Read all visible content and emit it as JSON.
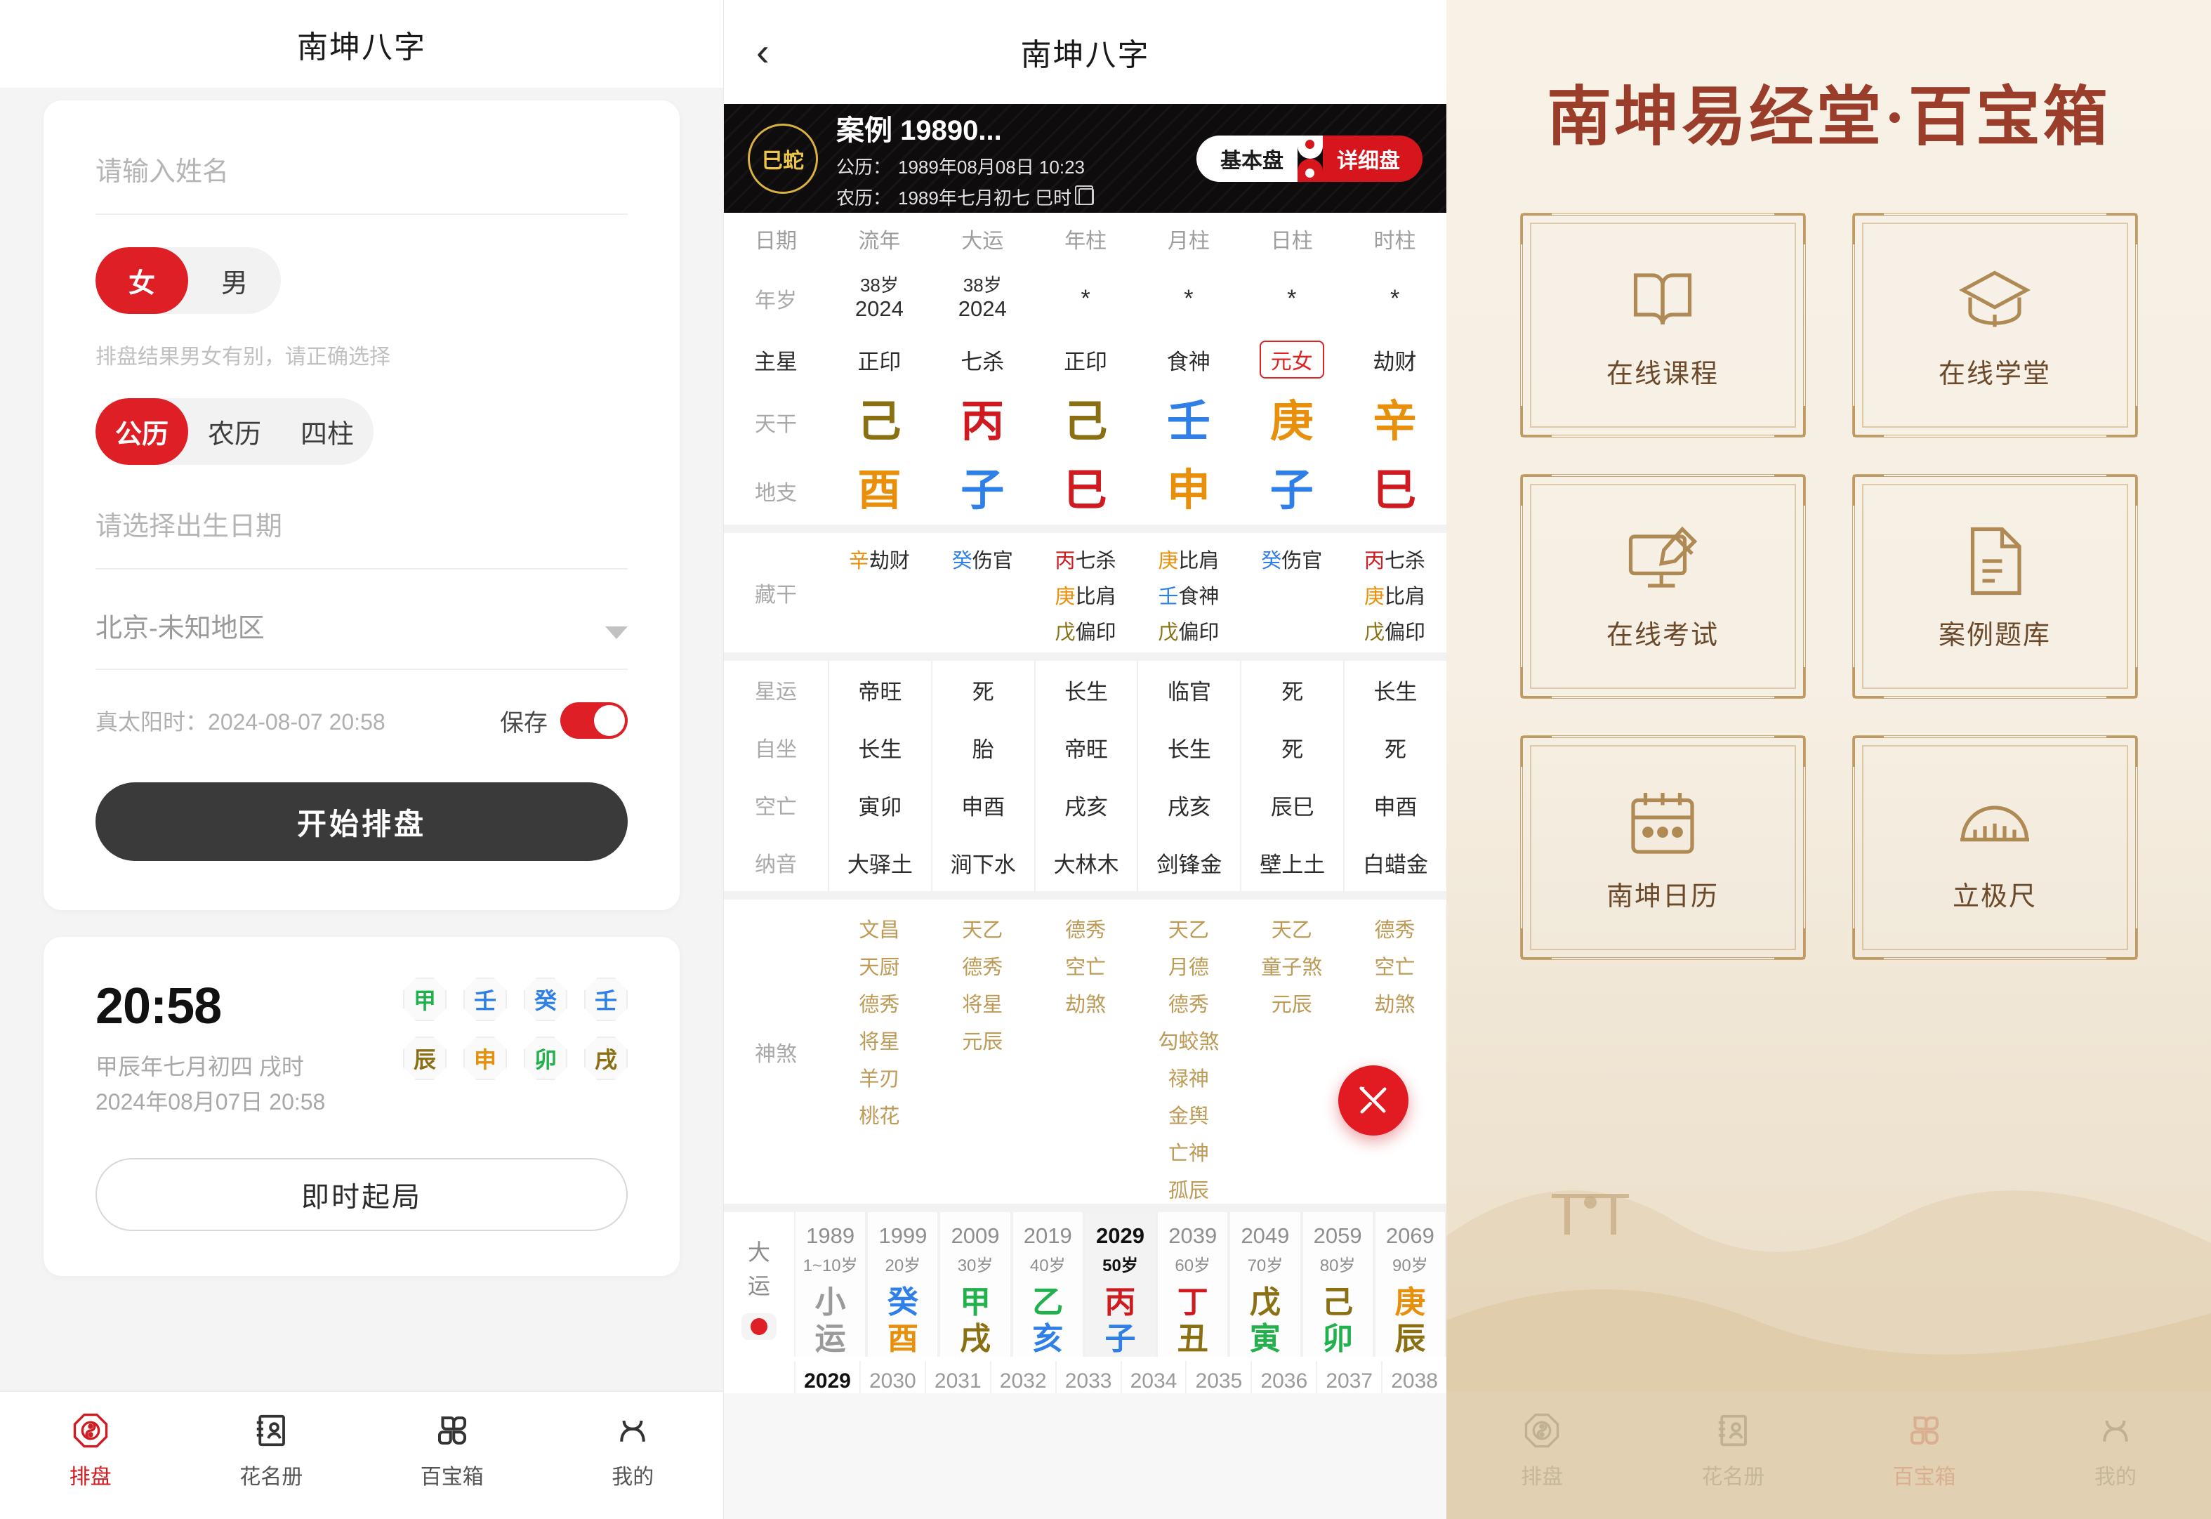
{
  "panel_form": {
    "title": "南坤八字",
    "name_placeholder": "请输入姓名",
    "gender": {
      "options": [
        "女",
        "男"
      ],
      "selected": "女"
    },
    "gender_hint": "排盘结果男女有别，请正确选择",
    "calendar": {
      "options": [
        "公历",
        "农历",
        "四柱"
      ],
      "selected": "公历"
    },
    "birthdate_placeholder": "请选择出生日期",
    "region_value": "北京-未知地区",
    "true_solar_label": "真太阳时：",
    "true_solar_value": "2024-08-07 20:58",
    "save_label": "保存",
    "save_on": true,
    "start_button": "开始排盘",
    "clock": {
      "time": "20:58",
      "lunar": "甲辰年七月初四 戌时",
      "solar": "2024年08月07日 20:58",
      "stems": [
        {
          "char": "甲",
          "color": "#22b14c"
        },
        {
          "char": "壬",
          "color": "#2e7fe8"
        },
        {
          "char": "癸",
          "color": "#2e7fe8"
        },
        {
          "char": "壬",
          "color": "#2e7fe8"
        }
      ],
      "branches": [
        {
          "char": "辰",
          "color": "#8a7012"
        },
        {
          "char": "申",
          "color": "#e8900c"
        },
        {
          "char": "卯",
          "color": "#22b14c"
        },
        {
          "char": "戌",
          "color": "#8a7012"
        }
      ]
    },
    "instant_button": "即时起局",
    "tabs": [
      {
        "label": "排盘",
        "icon": "bagua-icon",
        "active": true
      },
      {
        "label": "花名册",
        "icon": "roster-icon",
        "active": false
      },
      {
        "label": "百宝箱",
        "icon": "toolbox-icon",
        "active": false
      },
      {
        "label": "我的",
        "icon": "profile-icon",
        "active": false
      }
    ]
  },
  "panel_chart": {
    "title": "南坤八字",
    "back_icon": "chevron-left-icon",
    "banner": {
      "zodiac": "巳蛇",
      "case_name": "案例 19890...",
      "solar_label": "公历：",
      "solar_value": "1989年08月08日 10:23",
      "lunar_label": "农历：",
      "lunar_value": "1989年七月初七 巳时",
      "copy_icon": "copy-icon",
      "toggle": {
        "left": "基本盘",
        "right": "详细盘",
        "selected": "详细盘"
      }
    },
    "columns": [
      "日期",
      "流年",
      "大运",
      "年柱",
      "月柱",
      "日柱",
      "时柱"
    ],
    "rows": {
      "age_label": "年岁",
      "age": [
        {
          "top": "38岁",
          "bottom": "2024"
        },
        {
          "top": "38岁",
          "bottom": "2024"
        },
        {
          "top": "*",
          "bottom": ""
        },
        {
          "top": "*",
          "bottom": ""
        },
        {
          "top": "*",
          "bottom": ""
        },
        {
          "top": "*",
          "bottom": ""
        }
      ],
      "main_star_label": "主星",
      "main_star": [
        {
          "text": "正印",
          "badge": false
        },
        {
          "text": "七杀",
          "badge": false
        },
        {
          "text": "正印",
          "badge": false
        },
        {
          "text": "食神",
          "badge": false
        },
        {
          "text": "元女",
          "badge": true
        },
        {
          "text": "劫财",
          "badge": false
        }
      ],
      "stem_label": "天干",
      "stems": [
        {
          "char": "己",
          "color": "#8a7012"
        },
        {
          "char": "丙",
          "color": "#cf1a20"
        },
        {
          "char": "己",
          "color": "#8a7012"
        },
        {
          "char": "壬",
          "color": "#2e7fe8"
        },
        {
          "char": "庚",
          "color": "#e8900c"
        },
        {
          "char": "辛",
          "color": "#e8900c"
        }
      ],
      "branch_label": "地支",
      "branches": [
        {
          "char": "酉",
          "color": "#e8900c"
        },
        {
          "char": "子",
          "color": "#2e7fe8"
        },
        {
          "char": "巳",
          "color": "#cf1a20"
        },
        {
          "char": "申",
          "color": "#e8900c"
        },
        {
          "char": "子",
          "color": "#2e7fe8"
        },
        {
          "char": "巳",
          "color": "#cf1a20"
        }
      ],
      "hidden_label": "藏干",
      "hidden": [
        [
          {
            "g": "辛",
            "c": "#e8900c",
            "t": "劫财"
          }
        ],
        [
          {
            "g": "癸",
            "c": "#2e7fe8",
            "t": "伤官"
          }
        ],
        [
          {
            "g": "丙",
            "c": "#cf1a20",
            "t": "七杀"
          },
          {
            "g": "庚",
            "c": "#e8900c",
            "t": "比肩"
          },
          {
            "g": "戊",
            "c": "#8a7012",
            "t": "偏印"
          }
        ],
        [
          {
            "g": "庚",
            "c": "#e8900c",
            "t": "比肩"
          },
          {
            "g": "壬",
            "c": "#2e7fe8",
            "t": "食神"
          },
          {
            "g": "戊",
            "c": "#8a7012",
            "t": "偏印"
          }
        ],
        [
          {
            "g": "癸",
            "c": "#2e7fe8",
            "t": "伤官"
          }
        ],
        [
          {
            "g": "丙",
            "c": "#cf1a20",
            "t": "七杀"
          },
          {
            "g": "庚",
            "c": "#e8900c",
            "t": "比肩"
          },
          {
            "g": "戊",
            "c": "#8a7012",
            "t": "偏印"
          }
        ]
      ],
      "fortune_label": "星运",
      "fortune": [
        "帝旺",
        "死",
        "长生",
        "临官",
        "死",
        "长生"
      ],
      "selfsit_label": "自坐",
      "selfsit": [
        "长生",
        "胎",
        "帝旺",
        "长生",
        "死",
        "死"
      ],
      "void_label": "空亡",
      "void": [
        "寅卯",
        "申酉",
        "戌亥",
        "戌亥",
        "辰巳",
        "申酉"
      ],
      "nayin_label": "纳音",
      "nayin": [
        "大驿土",
        "涧下水",
        "大林木",
        "剑锋金",
        "壁上土",
        "白蜡金"
      ],
      "spirits_label": "神煞",
      "spirits": [
        [
          "文昌",
          "天厨",
          "德秀",
          "将星",
          "羊刃",
          "桃花"
        ],
        [
          "天乙",
          "德秀",
          "将星",
          "元辰"
        ],
        [
          "德秀",
          "空亡",
          "劫煞"
        ],
        [
          "天乙",
          "月德",
          "德秀",
          "勾蛟煞",
          "禄神",
          "金舆",
          "亡神",
          "孤辰"
        ],
        [
          "天乙",
          "童子煞",
          "元辰"
        ],
        [
          "德秀",
          "空亡",
          "劫煞"
        ]
      ]
    },
    "dayun": {
      "label_top": "大",
      "label_bottom": "运",
      "cells": [
        {
          "year": "1989",
          "age": "1~10岁",
          "stem": "小",
          "branch": "运",
          "sc": "#9a9a9a",
          "bc": "#9a9a9a",
          "selected": false
        },
        {
          "year": "1999",
          "age": "20岁",
          "stem": "癸",
          "branch": "酉",
          "sc": "#2e7fe8",
          "bc": "#e8900c",
          "selected": false
        },
        {
          "year": "2009",
          "age": "30岁",
          "stem": "甲",
          "branch": "戌",
          "sc": "#22b14c",
          "bc": "#8a7012",
          "selected": false
        },
        {
          "year": "2019",
          "age": "40岁",
          "stem": "乙",
          "branch": "亥",
          "sc": "#22b14c",
          "bc": "#2e7fe8",
          "selected": false
        },
        {
          "year": "2029",
          "age": "50岁",
          "stem": "丙",
          "branch": "子",
          "sc": "#cf1a20",
          "bc": "#2e7fe8",
          "selected": true
        },
        {
          "year": "2039",
          "age": "60岁",
          "stem": "丁",
          "branch": "丑",
          "sc": "#cf1a20",
          "bc": "#8a7012",
          "selected": false
        },
        {
          "year": "2049",
          "age": "70岁",
          "stem": "戊",
          "branch": "寅",
          "sc": "#8a7012",
          "bc": "#22b14c",
          "selected": false
        },
        {
          "year": "2059",
          "age": "80岁",
          "stem": "己",
          "branch": "卯",
          "sc": "#8a7012",
          "bc": "#22b14c",
          "selected": false
        },
        {
          "year": "2069",
          "age": "90岁",
          "stem": "庚",
          "branch": "辰",
          "sc": "#e8900c",
          "bc": "#8a7012",
          "selected": false
        }
      ],
      "liunian": [
        "2029",
        "2030",
        "2031",
        "2032",
        "2033",
        "2034",
        "2035",
        "2036",
        "2037",
        "2038"
      ]
    },
    "fab_icon": "tools-icon"
  },
  "panel_toolbox": {
    "title": "南坤易经堂·百宝箱",
    "tiles": [
      {
        "label": "在线课程",
        "icon": "book-icon"
      },
      {
        "label": "在线学堂",
        "icon": "academy-icon"
      },
      {
        "label": "在线考试",
        "icon": "exam-icon"
      },
      {
        "label": "案例题库",
        "icon": "casebank-icon"
      },
      {
        "label": "南坤日历",
        "icon": "calendar-icon"
      },
      {
        "label": "立极尺",
        "icon": "protractor-icon"
      }
    ],
    "tabs": [
      {
        "label": "排盘",
        "icon": "bagua-icon",
        "active": false
      },
      {
        "label": "花名册",
        "icon": "roster-icon",
        "active": false
      },
      {
        "label": "百宝箱",
        "icon": "toolbox-icon",
        "active": true
      },
      {
        "label": "我的",
        "icon": "profile-icon",
        "active": false
      }
    ]
  },
  "colors": {
    "brand_red": "#de1f25",
    "gold": "#c9a878",
    "title_brown": "#9a3d2a"
  }
}
